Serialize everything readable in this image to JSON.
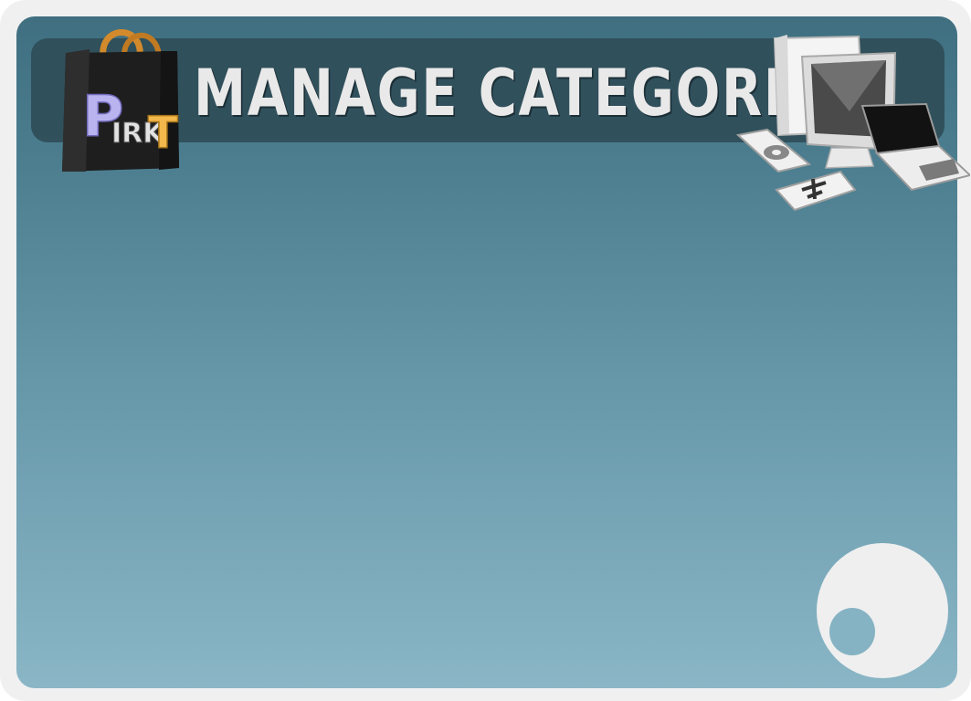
{
  "header": {
    "title": "MANAGE CATEGORIS"
  },
  "logo": {
    "letters": [
      "P",
      "IRK",
      "T"
    ]
  },
  "icons": {
    "logo": "shopping-bag-icon",
    "devices": "computer-devices-icon",
    "decoration": "circle-decoration"
  },
  "colors": {
    "frame": "#f0f0f0",
    "panel_top": "#3f6f80",
    "panel_bottom": "#8ab6c6",
    "header_bar": "#2f4d58",
    "title_text": "#e9e9e9",
    "logo_letter_p": "#b9b3ef",
    "logo_letter_t": "#f2b84b"
  }
}
